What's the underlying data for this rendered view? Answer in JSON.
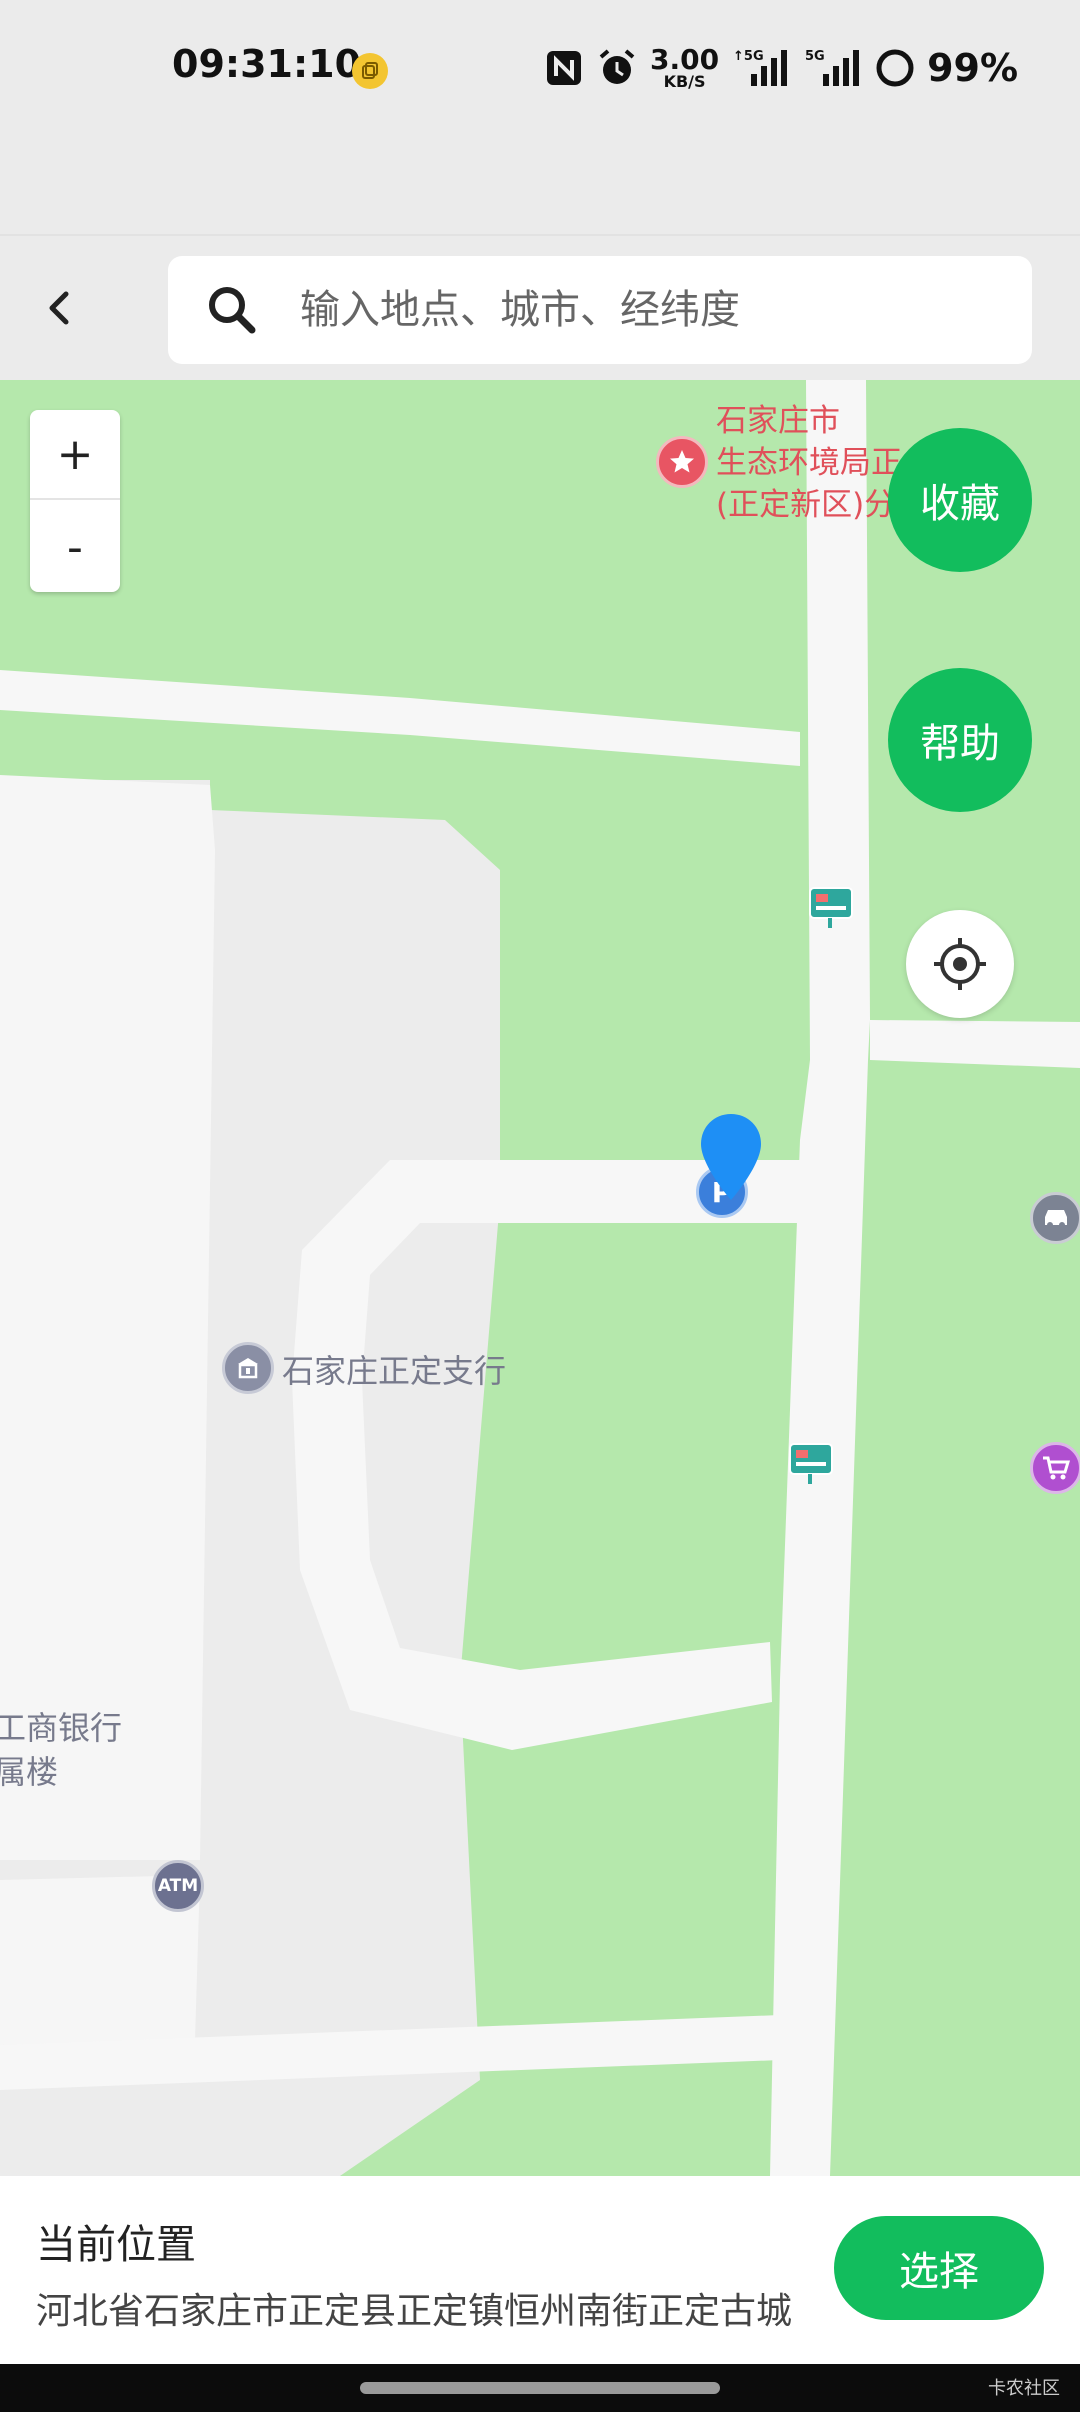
{
  "status_bar": {
    "time": "09:31:10",
    "net_speed_value": "3.00",
    "net_speed_unit": "KB/S",
    "signal_1_label": "5G",
    "signal_2_label": "5G",
    "battery": "99%"
  },
  "search": {
    "placeholder": "输入地点、城市、经纬度"
  },
  "map": {
    "zoom_in": "+",
    "zoom_out": "-",
    "favorite_label": "收藏",
    "help_label": "帮助",
    "poi_eco_line1": "石家庄市",
    "poi_eco_line2": "生态环境局正",
    "poi_eco_line3": "(正定新区)分",
    "poi_bank": "石家庄正定支行",
    "poi_icbc_line1": "工商银行",
    "poi_icbc_line2": "属楼",
    "atm_label": "ATM",
    "parking_label": "P"
  },
  "bottom": {
    "title": "当前位置",
    "address": "河北省石家庄市正定县正定镇恒州南街正定古城",
    "select_label": "选择"
  },
  "nav": {
    "watermark": "卡农社区"
  },
  "colors": {
    "accent": "#12bd5d",
    "map_green": "#b5e8ac",
    "pin_blue": "#1e8ff5",
    "poi_red": "#e0505a"
  },
  "icons": [
    "nfc-icon",
    "alarm-icon",
    "signal-icon",
    "battery-ring-icon",
    "back-icon",
    "search-icon",
    "locate-icon",
    "location-pin-icon",
    "parking-icon",
    "bank-icon",
    "atm-icon",
    "bus-stop-icon",
    "car-icon",
    "shopping-cart-icon",
    "star-icon"
  ]
}
